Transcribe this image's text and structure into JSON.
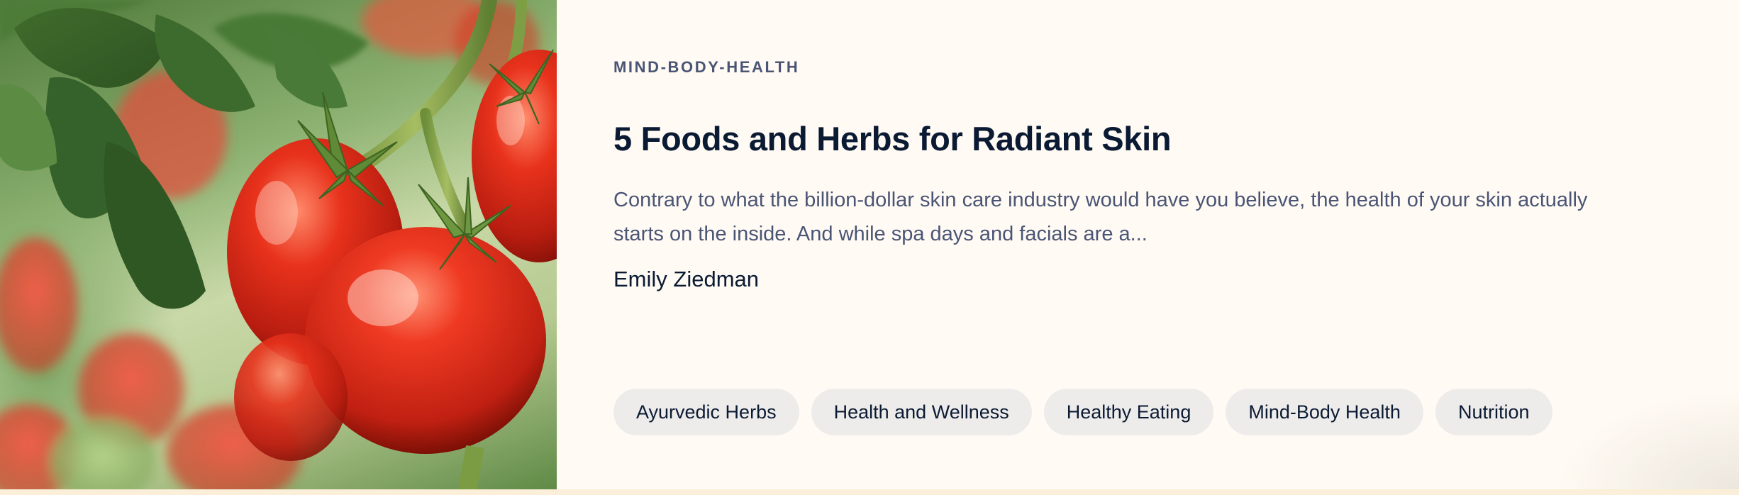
{
  "article": {
    "category": "MIND-BODY-HEALTH",
    "title": "5 Foods and Herbs for Radiant Skin",
    "excerpt": "Contrary to what the billion-dollar skin care industry would have you believe, the health of your skin actually starts on the inside. And while spa days and facials are a...",
    "author": "Emily Ziedman",
    "tags": [
      "Ayurvedic Herbs",
      "Health and Wellness",
      "Healthy Eating",
      "Mind-Body Health",
      "Nutrition"
    ]
  },
  "colors": {
    "background": "#fffaf3",
    "heading": "#0b1a33",
    "muted_text": "#4a5575",
    "tag_background": "#eeeceb"
  },
  "image": {
    "subject": "tomatoes-on-vine-photo"
  }
}
